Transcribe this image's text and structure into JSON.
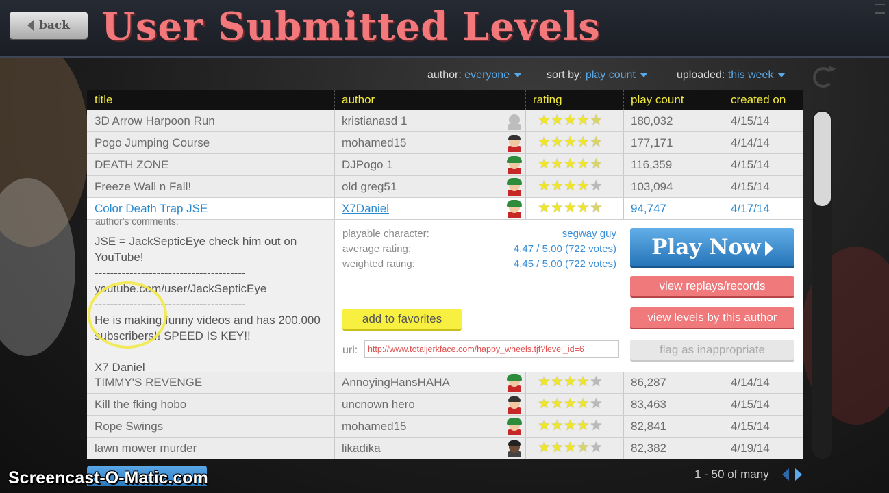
{
  "header": {
    "back_label": "back",
    "title": "User Submitted Levels"
  },
  "filters": {
    "author_label": "author:",
    "author_value": "everyone",
    "sort_label": "sort by:",
    "sort_value": "play count",
    "uploaded_label": "uploaded:",
    "uploaded_value": "this week"
  },
  "table": {
    "columns": [
      "title",
      "author",
      "rating",
      "play count",
      "created on"
    ],
    "rows": [
      {
        "title": "3D Arrow Harpoon Run",
        "author": "kristianasd 1",
        "character": "gray",
        "stars": 4.5,
        "play_count": "180,032",
        "created": "4/15/14"
      },
      {
        "title": "Pogo Jumping Course",
        "author": "mohamed15",
        "character": "wheelchair",
        "stars": 4.5,
        "play_count": "177,171",
        "created": "4/14/14"
      },
      {
        "title": "DEATH ZONE",
        "author": "DJPogo 1",
        "character": "segway",
        "stars": 4.5,
        "play_count": "116,359",
        "created": "4/15/14"
      },
      {
        "title": "Freeze Wall n Fall!",
        "author": "old greg51",
        "character": "segway",
        "stars": 4,
        "play_count": "103,094",
        "created": "4/15/14"
      },
      {
        "title": "Color Death Trap JSE",
        "author": "X7Daniel",
        "character": "segway",
        "stars": 4.5,
        "play_count": "94,747",
        "created": "4/17/14"
      },
      {
        "title": "TIMMY'S REVENGE",
        "author": "AnnoyingHansHAHA",
        "character": "segway",
        "stars": 4,
        "play_count": "86,287",
        "created": "4/14/14"
      },
      {
        "title": "Kill the fking hobo",
        "author": "uncnown hero",
        "character": "wheelchair",
        "stars": 4,
        "play_count": "83,463",
        "created": "4/15/14"
      },
      {
        "title": "Rope Swings",
        "author": "mohamed15",
        "character": "segway",
        "stars": 4,
        "play_count": "82,841",
        "created": "4/15/14"
      },
      {
        "title": "lawn mower murder",
        "author": "likadika",
        "character": "dark",
        "stars": 3.5,
        "play_count": "82,382",
        "created": "4/19/14"
      }
    ]
  },
  "detail": {
    "comments_label": "author's comments:",
    "comments": "JSE = JackSepticEye check him out on YouTube!\n---------------------------------------\nyoutube.com/user/JackSepticEye\n---------------------------------------\nHe is making funny videos and has 200.000 subscribers!! SPEED IS KEY!!",
    "signature": "X7 Daniel",
    "playable_label": "playable character:",
    "playable_value": "segway guy",
    "avg_label": "average rating:",
    "avg_value": "4.47 / 5.00 (722 votes)",
    "weighted_label": "weighted rating:",
    "weighted_value": "4.45 / 5.00 (722 votes)",
    "favorites_label": "add to favorites",
    "url_label": "url:",
    "url_value": "http://www.totaljerkface.com/happy_wheels.tjf?level_id=6",
    "play_label": "Play Now",
    "replays_label": "view replays/records",
    "levels_by_author_label": "view levels by this author",
    "flag_label": "flag as inappropriate"
  },
  "pager": {
    "text": "1 - 50 of many"
  },
  "watermark": "Screencast-O-Matic.com",
  "colors": {
    "title_pink": "#f2787b",
    "header_yellow": "#f2ea3c",
    "link_blue": "#2a8ad0",
    "play_blue": "#2574b8",
    "button_red": "#f0797c",
    "favorite_yellow": "#f7f040"
  }
}
